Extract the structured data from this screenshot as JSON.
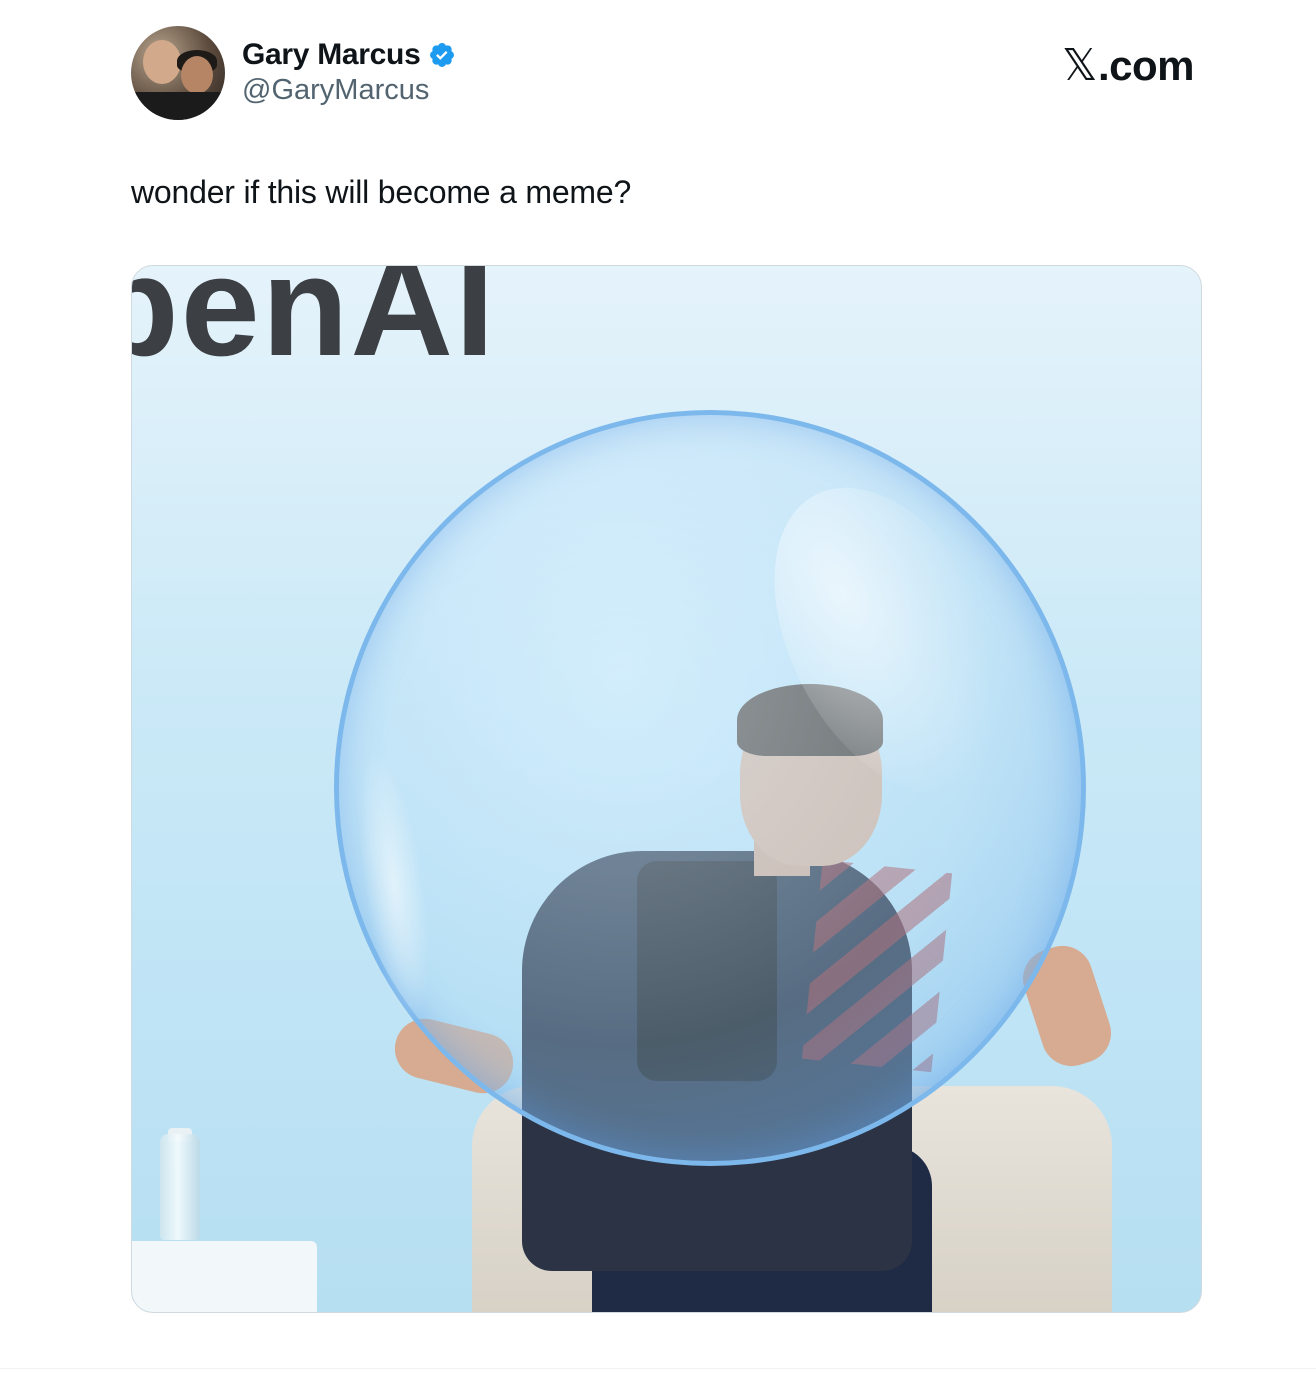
{
  "author": {
    "display_name": "Gary Marcus",
    "handle": "@GaryMarcus",
    "verified": true,
    "avatar_icon": "avatar-photo"
  },
  "brand": {
    "x_glyph": "𝕏",
    "domain": ".com"
  },
  "tweet": {
    "text": "wonder if this will become a meme?"
  },
  "media": {
    "visible_text": "penAI",
    "colors": {
      "bubble_outline": "#7db8ec",
      "background": "#cbe9f7"
    }
  },
  "colors": {
    "verified_badge": "#1d9bf0",
    "text_primary": "#0f1419",
    "text_secondary": "#536471"
  }
}
